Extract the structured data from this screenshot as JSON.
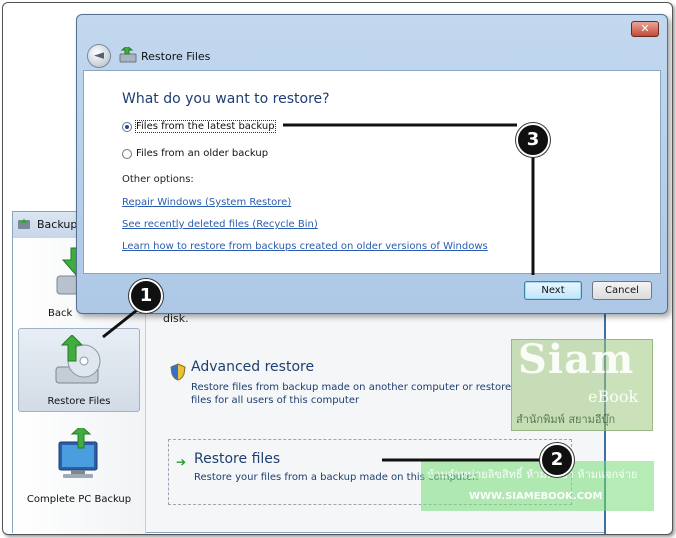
{
  "background_window": {
    "title": "Backup",
    "nav": {
      "back_label": "Back",
      "restore_label": "Restore Files",
      "complete_label": "Complete PC Backup"
    },
    "disk_text": "disk.",
    "advanced": {
      "title": "Advanced restore",
      "description": "Restore files from backup made on another computer or restore files for all users of this computer"
    },
    "restore_files": {
      "title": "Restore files",
      "description": "Restore your files from a backup made on this computer."
    }
  },
  "dialog": {
    "title": "Restore Files",
    "close_label": "✕",
    "heading": "What do you want to restore?",
    "options": [
      {
        "label": "Files from the latest backup",
        "selected": true
      },
      {
        "label": "Files from an older backup",
        "selected": false
      }
    ],
    "other_options_label": "Other options:",
    "links": [
      "Repair Windows (System Restore)",
      "See recently deleted files (Recycle Bin)",
      "Learn how to restore from backups created on older versions of Windows"
    ],
    "buttons": {
      "next": "Next",
      "cancel": "Cancel"
    }
  },
  "callouts": [
    "1",
    "2",
    "3"
  ],
  "watermark": {
    "brand": "Siam",
    "sub": "eBook",
    "thai_1": "สำนักพิมพ์ สยามอีบุ๊ก",
    "thai_2": "ห้ามจำหน่ายลิขสิทธิ์ ห้ามทำซ้ำ ห้ามแจกจ่าย",
    "url": "WWW.SIAMEBOOK.COM"
  },
  "colors": {
    "link": "#2a5db0",
    "heading": "#1f3e73",
    "title_bar": "#c2d8ef"
  }
}
